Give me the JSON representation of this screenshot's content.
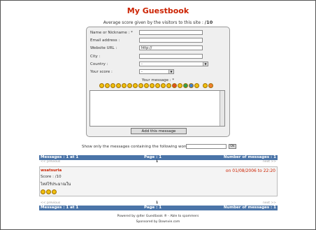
{
  "title": "My Guestbook",
  "average": {
    "text": "Average score given by the visitors to this site :",
    "value": "/10"
  },
  "form": {
    "name_label": "Name or Nickname :  *",
    "email_label": "Email address :",
    "website_label": "Website URL :",
    "website_value": "http://",
    "city_label": "City :",
    "country_label": "Country :",
    "country_value": "-",
    "score_label": "Your score :",
    "score_value": "-",
    "message_label": "Your message :  *",
    "submit_label": "Add this message"
  },
  "filter": {
    "label": "Show only the messages containing the following words :",
    "button": "Ok"
  },
  "pagination": {
    "messages_label": "Messages : 1 at 1",
    "page_label": "Page : 1",
    "total_label": "Number of messages : 1",
    "prev": "<< previous",
    "next": "next >>",
    "page_number": "1"
  },
  "entry": {
    "name": "wsatsuria",
    "date": "on 01/08/2006 to 22:20",
    "score": "Score :  /10",
    "text": "ไหล่ไร้ประมาณใน"
  },
  "footer": {
    "powered": "Powered by @lter Guestbook ® - Able to spammers",
    "sponsored": "Sponsored by Downvie.com"
  }
}
